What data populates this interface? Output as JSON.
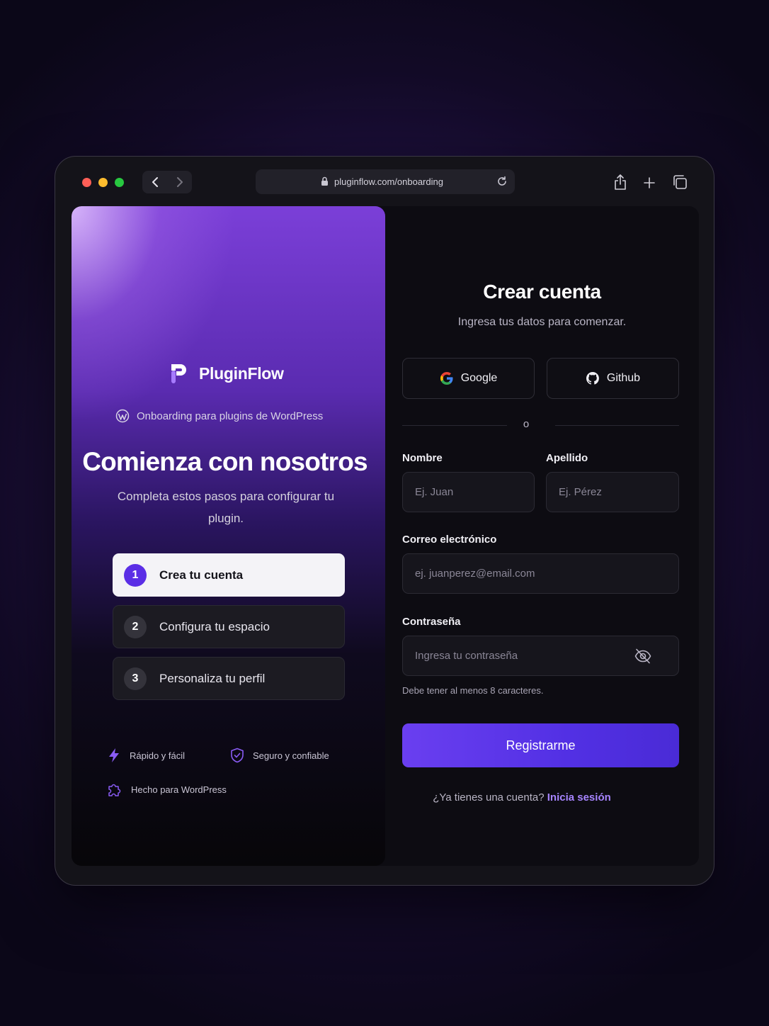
{
  "browser": {
    "url": "pluginflow.com/onboarding"
  },
  "brand": {
    "name": "PluginFlow",
    "tagline": "Onboarding para plugins de WordPress"
  },
  "hero": {
    "title": "Comienza con nosotros",
    "subtitle": "Completa estos pasos para configurar tu plugin."
  },
  "steps": [
    {
      "number": "1",
      "label": "Crea tu cuenta",
      "active": true
    },
    {
      "number": "2",
      "label": "Configura tu espacio",
      "active": false
    },
    {
      "number": "3",
      "label": "Personaliza tu perfil",
      "active": false
    }
  ],
  "features": [
    {
      "label": "Rápido y fácil",
      "icon": "lightning-icon"
    },
    {
      "label": "Seguro y confiable",
      "icon": "shield-check-icon"
    },
    {
      "label": "Hecho para WordPress",
      "icon": "puzzle-icon"
    }
  ],
  "form": {
    "title": "Crear cuenta",
    "subtitle": "Ingresa tus datos para comenzar.",
    "google_label": "Google",
    "github_label": "Github",
    "divider_text": "o",
    "first_name": {
      "label": "Nombre",
      "placeholder": "Ej. Juan"
    },
    "last_name": {
      "label": "Apellido",
      "placeholder": "Ej. Pérez"
    },
    "email": {
      "label": "Correo electrónico",
      "placeholder": "ej. juanperez@email.com"
    },
    "password": {
      "label": "Contraseña",
      "placeholder": "Ingresa tu contraseña",
      "hint": "Debe tener al menos 8 caracteres."
    },
    "submit_label": "Registrarme",
    "login_prompt": "¿Ya tienes una cuenta?",
    "login_link": "Inicia sesión"
  },
  "colors": {
    "accent": "#5b2ee6",
    "link": "#a785ff",
    "background": "#0d0c12"
  }
}
